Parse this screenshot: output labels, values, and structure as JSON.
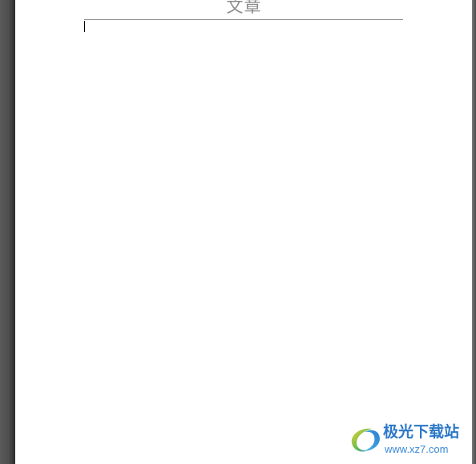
{
  "document": {
    "header_title": "文章",
    "body_text": ""
  },
  "watermark": {
    "brand": "极光下载站",
    "url": "www.xz7.com",
    "logo_icon": "aurora-swirl-logo-icon"
  },
  "colors": {
    "header_text": "#8a8a8a",
    "watermark_blue": "#2b78c8",
    "workspace_gray": "#5b5b5b"
  }
}
